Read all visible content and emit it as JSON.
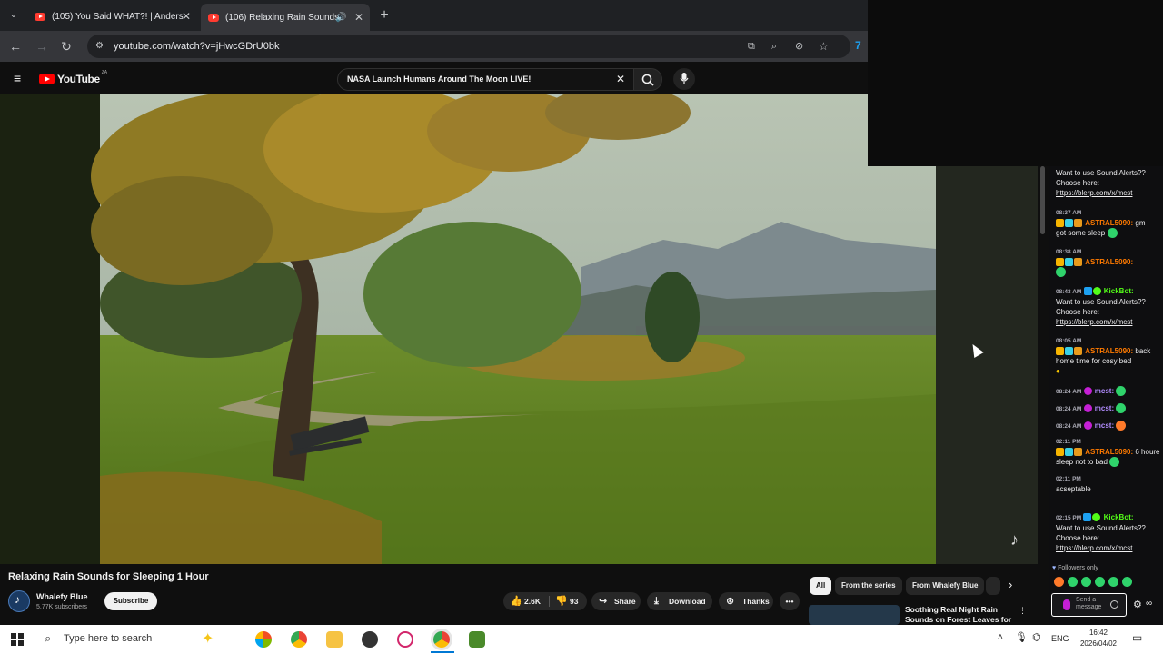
{
  "tabs": [
    {
      "title": "(105) You Said WHAT?! | Anders",
      "active": false
    },
    {
      "title": "(106) Relaxing Rain Sounds",
      "active": true
    }
  ],
  "address": {
    "url": "youtube.com/watch?v=jHwcGDrU0bk"
  },
  "youtube": {
    "logo": "YouTube",
    "logo_badge": "ZA",
    "search_value": "NASA Launch Humans Around The Moon LIVE!"
  },
  "video": {
    "title": "Relaxing Rain Sounds for Sleeping 1 Hour",
    "channel": "Whalefy Blue",
    "subscribers": "5.77K subscribers",
    "subscribe_label": "Subscribe",
    "likes": "2.6K",
    "dislikes": "93",
    "share_label": "Share",
    "download_label": "Download",
    "thanks_label": "Thanks"
  },
  "chips": [
    "All",
    "From the series",
    "From Whalefy Blue"
  ],
  "next_video": {
    "title_line1": "Soothing Real Night Rain",
    "title_line2": "Sounds on Forest Leaves for ..."
  },
  "chat": {
    "messages": [
      {
        "ts": "",
        "user": "",
        "text": "Want to use Sound Alerts?? Choose here:",
        "link": "https://blerp.com/x/mcst"
      },
      {
        "ts": "08:37 AM",
        "user": "ASTRAL5090:",
        "text": "gm i got some sleep",
        "link": ""
      },
      {
        "ts": "08:38 AM",
        "user": "ASTRAL5090:",
        "text": "",
        "link": ""
      },
      {
        "ts": "08:43 AM",
        "user": "KickBot:",
        "text": "Want to use Sound Alerts?? Choose here:",
        "link": "https://blerp.com/x/mcst"
      },
      {
        "ts": "08:05 AM",
        "user": "ASTRAL5090:",
        "text": "back home time for cosy bed",
        "link": ""
      },
      {
        "ts": "08:24 AM",
        "user": "mcst:",
        "text": "",
        "link": ""
      },
      {
        "ts": "08:24 AM",
        "user": "mcst:",
        "text": "",
        "link": ""
      },
      {
        "ts": "08:24 AM",
        "user": "mcst:",
        "text": "",
        "link": ""
      },
      {
        "ts": "02:11 PM",
        "user": "ASTRAL5090:",
        "text": "6 houre sleep not to bad",
        "link": ""
      },
      {
        "ts": "02:11 PM",
        "user": "",
        "text": "acseptable",
        "link": ""
      },
      {
        "ts": "02:15 PM",
        "user": "KickBot:",
        "text": "Want to use Sound Alerts?? Choose here:",
        "link": "https://blerp.com/x/mcst"
      }
    ],
    "followers_only": "Followers only",
    "send_placeholder": "Send a message"
  },
  "taskbar": {
    "search_placeholder": "Type here to search",
    "lang": "ENG",
    "time": "16:42",
    "date": "2026/04/02"
  },
  "colors": {
    "youtube_red": "#ff0000",
    "kick_green": "#53fc18",
    "astral_orange": "#ff7a00"
  }
}
